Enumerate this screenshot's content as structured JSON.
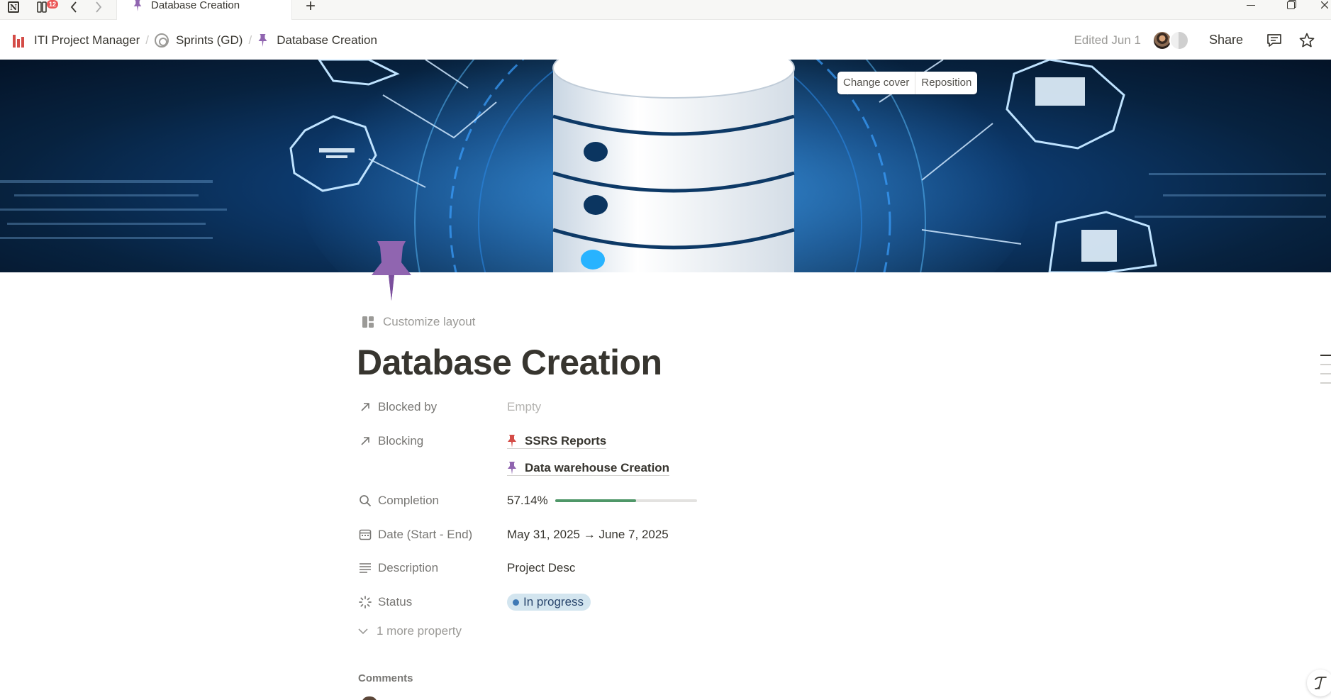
{
  "titlebar": {
    "app_icon": "notion-logo-icon",
    "app_glyph": "N",
    "inbox_badge": "12",
    "tab_title": "Database Creation",
    "new_tab_glyph": "+"
  },
  "breadcrumb": [
    {
      "label": "ITI Project Manager",
      "icon": "iti-logo-icon"
    },
    {
      "label": "Sprints (GD)",
      "icon": "target-icon"
    },
    {
      "label": "Database Creation",
      "icon": "pushpin-icon"
    }
  ],
  "topbar": {
    "edited": "Edited Jun 1",
    "share": "Share"
  },
  "cover": {
    "change_cover": "Change cover",
    "reposition": "Reposition"
  },
  "page": {
    "customize_layout": "Customize layout",
    "title": "Database Creation",
    "icon_color": "#9065b0"
  },
  "properties": {
    "blocked_by": {
      "name": "Blocked by",
      "icon": "arrow-up-right-icon",
      "value": "Empty"
    },
    "blocking": {
      "name": "Blocking",
      "icon": "arrow-up-right-icon",
      "items": [
        {
          "label": "SSRS Reports",
          "pin_color": "#d44c47"
        },
        {
          "label": "Data warehouse Creation",
          "pin_color": "#9065b0"
        }
      ]
    },
    "completion": {
      "name": "Completion",
      "icon": "search-icon",
      "value": "57.14%",
      "fraction": 0.5714,
      "bar_color": "#4f9768"
    },
    "date": {
      "name": "Date (Start - End)",
      "icon": "calendar-icon",
      "value": "May 31, 2025 → June 7, 2025"
    },
    "description": {
      "name": "Description",
      "icon": "text-lines-icon",
      "value": "Project Desc"
    },
    "status": {
      "name": "Status",
      "icon": "status-spinner-icon",
      "value": "In progress",
      "color": "#d3e5ef",
      "dot_color": "#3f79b5"
    }
  },
  "more_properties": "1 more property",
  "comments_label": "Comments"
}
